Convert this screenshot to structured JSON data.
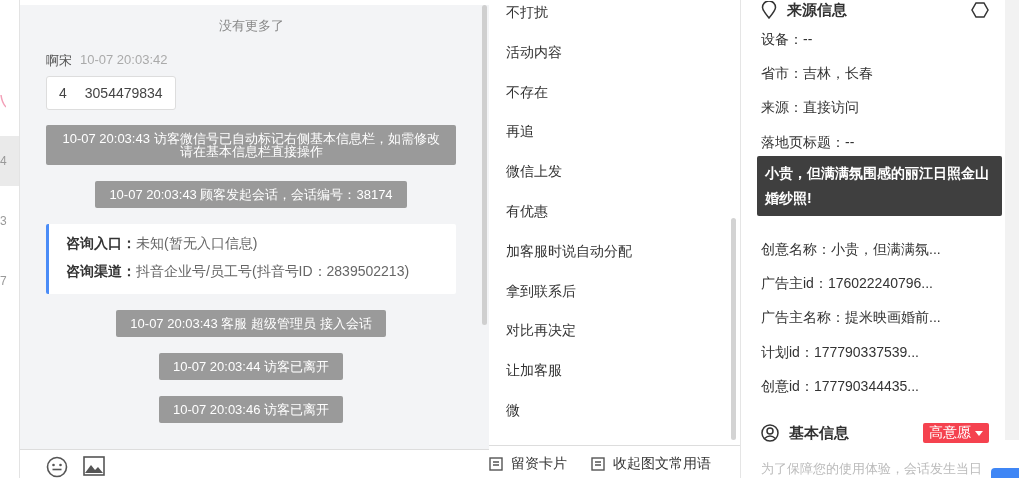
{
  "sidebar": [
    {
      "kind": "mark",
      "selected": false
    },
    {
      "kind": "text",
      "text": "4",
      "selected": true
    },
    {
      "kind": "text",
      "text": "3",
      "selected": false
    },
    {
      "kind": "text",
      "text": "7",
      "selected": false
    }
  ],
  "chat": {
    "end_notice": "没有更多了",
    "messages": [
      {
        "kind": "bubble",
        "sender": "啊宋",
        "time": "10-07 20:03:42",
        "parts": [
          "4",
          "3054479834"
        ]
      },
      {
        "kind": "system",
        "text": "10-07 20:03:43 访客微信号已自动标记右侧基本信息栏，如需修改请在基本信息栏直接操作"
      },
      {
        "kind": "system",
        "text": "10-07 20:03:43 顾客发起会话，会话编号：38174"
      },
      {
        "kind": "info",
        "rows": [
          {
            "label": "咨询入口：",
            "value": "未知(暂无入口信息)"
          },
          {
            "label": "咨询渠道：",
            "value": "抖音企业号/员工号(抖音号ID：2839502213)"
          }
        ]
      },
      {
        "kind": "system",
        "text": "10-07 20:03:43 客服 超级管理员 接入会话"
      },
      {
        "kind": "system",
        "text": "10-07 20:03:44 访客已离开"
      },
      {
        "kind": "system",
        "text": "10-07 20:03:46 访客已离开"
      }
    ]
  },
  "quick_phrases": [
    "不打扰",
    "活动内容",
    "不存在",
    "再追",
    "微信上发",
    "有优惠",
    "加客服时说自动分配",
    "拿到联系后",
    "对比再决定",
    "让加客服",
    "微"
  ],
  "quick_bar": [
    "留资卡片",
    "收起图文常用语"
  ],
  "source_info": {
    "title": "来源信息",
    "fields": [
      "设备：--",
      "省市：吉林，长春",
      "来源：直接访问",
      "落地页标题：--",
      "创意名称：小贵，但满满氛...",
      "广告主id：176022240796...",
      "广告主名称：提米映画婚前...",
      "计划id：177790337539...",
      "创意id：177790344435..."
    ]
  },
  "tooltip": "小贵，但满满氛围感的丽江日照金山婚纱照!",
  "basic_info": {
    "title": "基本信息",
    "tag": "高意愿",
    "hint": "为了保障您的使用体验，会话发生当日"
  }
}
